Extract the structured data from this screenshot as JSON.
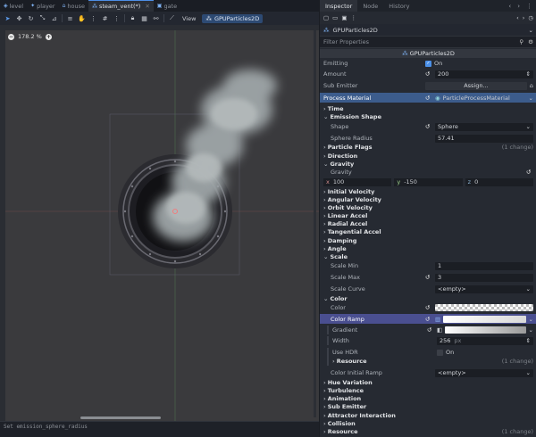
{
  "scene_tabs": [
    {
      "label": "level",
      "icon": "level-icon",
      "active": false
    },
    {
      "label": "player",
      "icon": "player-icon",
      "active": false
    },
    {
      "label": "house",
      "icon": "house-icon",
      "active": false
    },
    {
      "label": "steam_vent(*)",
      "icon": "particles-icon",
      "active": true
    },
    {
      "label": "gate",
      "icon": "gate-icon",
      "active": false
    }
  ],
  "toolbar": {
    "view_label": "View",
    "node_label": "GPUParticles2D"
  },
  "viewport": {
    "zoom": "178.2 %",
    "zoom_out": "−",
    "zoom_in": "+"
  },
  "output": {
    "line1": "Set emission_sphere_radius",
    "line2": "",
    "hint": ""
  },
  "inspector": {
    "tabs": [
      "Inspector",
      "Node",
      "History"
    ],
    "node_name": "GPUParticles2D",
    "path": "GPUParticles2D",
    "filter_placeholder": "Filter Properties",
    "class_header": "GPUParticles2D",
    "emitting_label": "Emitting",
    "emitting_value": "On",
    "amount_label": "Amount",
    "amount_value": "200",
    "sub_emitter_label": "Sub Emitter",
    "sub_emitter_value": "Assign...",
    "process_material_label": "Process Material",
    "process_material_value": "ParticleProcessMaterial",
    "time": "Time",
    "emission_shape": "Emission Shape",
    "shape_label": "Shape",
    "shape_value": "Sphere",
    "sphere_radius_label": "Sphere Radius",
    "sphere_radius_value": "57.41",
    "particle_flags": "Particle Flags",
    "particle_flags_change": "(1 change)",
    "direction": "Direction",
    "gravity_section": "Gravity",
    "gravity_label": "Gravity",
    "gravity_x": "100",
    "gravity_y": "-150",
    "gravity_z": "0",
    "x": "x",
    "y": "y",
    "z": "z",
    "initial_velocity": "Initial Velocity",
    "angular_velocity": "Angular Velocity",
    "orbit_velocity": "Orbit Velocity",
    "linear_accel": "Linear Accel",
    "radial_accel": "Radial Accel",
    "tangential_accel": "Tangential Accel",
    "damping": "Damping",
    "angle": "Angle",
    "scale_section": "Scale",
    "scale_min_label": "Scale Min",
    "scale_min_value": "1",
    "scale_max_label": "Scale Max",
    "scale_max_value": "3",
    "scale_curve_label": "Scale Curve",
    "scale_curve_value": "<empty>",
    "color_section": "Color",
    "color_label": "Color",
    "color_ramp_label": "Color Ramp",
    "gradient_label": "Gradient",
    "width_label": "Width",
    "width_value": "256",
    "width_unit": "px",
    "use_hdr_label": "Use HDR",
    "use_hdr_value": "On",
    "resource_label": "Resource",
    "resource_change": "(1 change)",
    "color_initial_ramp_label": "Color Initial Ramp",
    "color_initial_ramp_value": "<empty>",
    "hue_variation": "Hue Variation",
    "turbulence": "Turbulence",
    "animation": "Animation",
    "sub_emitter_section": "Sub Emitter",
    "attractor_interaction": "Attractor Interaction",
    "collision": "Collision",
    "resource_section": "Resource",
    "resource_section_change": "(1 change)"
  },
  "colors": {
    "accent": "#4b90e8",
    "highlight_row": "#3c5c8c",
    "color_ramp_row": "#4a4f90"
  }
}
